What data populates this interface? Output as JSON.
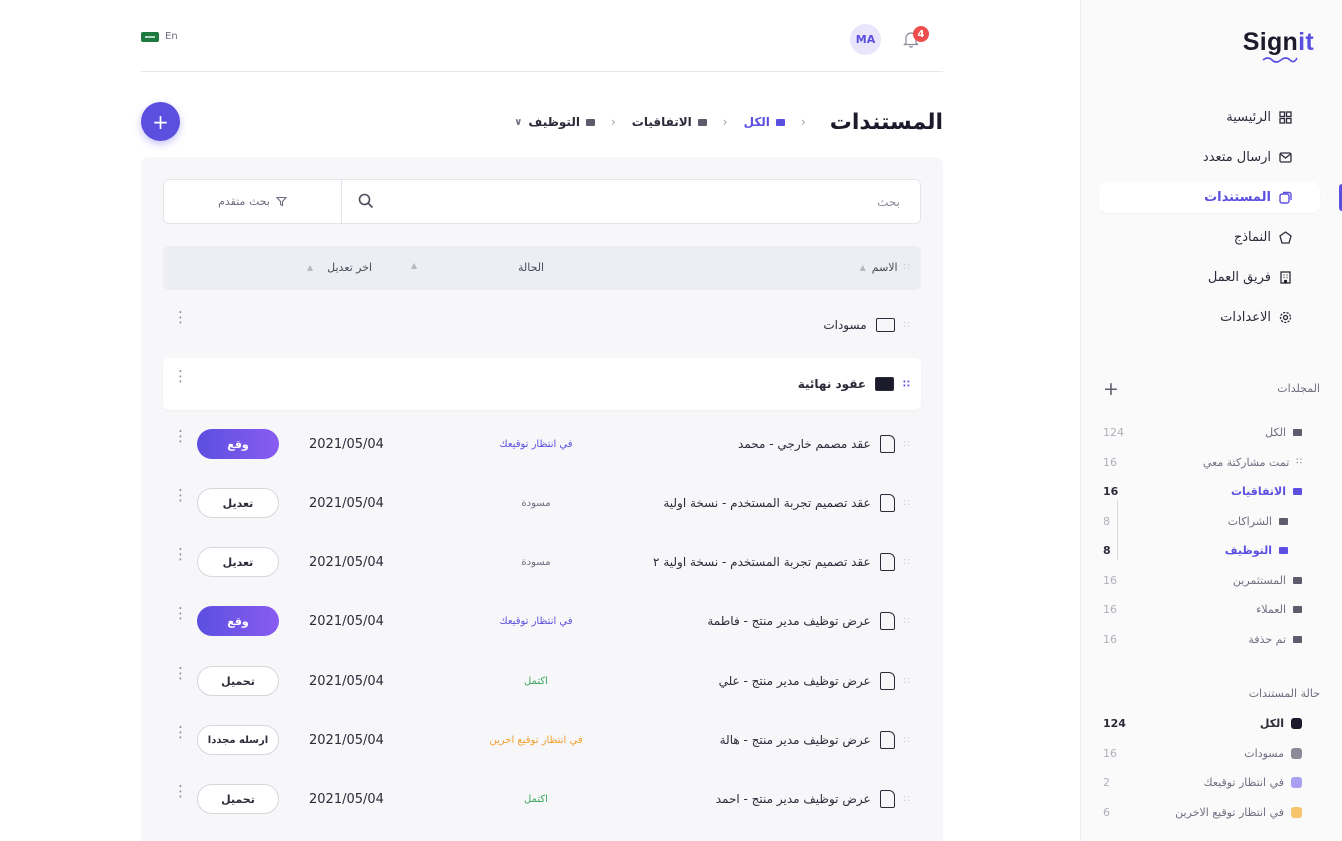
{
  "app": {
    "logo_prefix": "Sign",
    "logo_suffix": "it"
  },
  "topbar": {
    "language": "En",
    "avatar_initials": "MA",
    "notifications_count": "4"
  },
  "nav": {
    "items": [
      {
        "label": "الرئيسية",
        "icon": "grid-icon",
        "active": false
      },
      {
        "label": "ارسال متعدد",
        "icon": "mail-icon",
        "active": false
      },
      {
        "label": "المستندات",
        "icon": "documents-icon",
        "active": true
      },
      {
        "label": "النماذج",
        "icon": "template-icon",
        "active": false
      },
      {
        "label": "فريق العمل",
        "icon": "building-icon",
        "active": false
      },
      {
        "label": "الاعدادات",
        "icon": "gear-icon",
        "active": false
      }
    ]
  },
  "folders": {
    "title": "المجلدات",
    "items": [
      {
        "label": "الكل",
        "count": "124"
      },
      {
        "label": "تمت مشاركتة معي",
        "count": "16"
      },
      {
        "label": "الاتفاقيات",
        "count": "16"
      },
      {
        "label": "الشراكات",
        "count": "8"
      },
      {
        "label": "التوظيف",
        "count": "8"
      },
      {
        "label": "المستثمرين",
        "count": "16"
      },
      {
        "label": "العملاء",
        "count": "16"
      },
      {
        "label": "تم حذفة",
        "count": "16"
      }
    ]
  },
  "doc_status": {
    "title": "حالة المستندات",
    "items": [
      {
        "label": "الكل",
        "count": "124",
        "color": "#1b1b2b"
      },
      {
        "label": "مسودات",
        "count": "16",
        "color": "#8a8a98"
      },
      {
        "label": "في انتظار توقيعك",
        "count": "2",
        "color": "#a9a0f0"
      },
      {
        "label": "في انتظار توقيع الاخرين",
        "count": "6",
        "color": "#f5c46b"
      }
    ]
  },
  "header": {
    "title": "المستندات",
    "breadcrumbs": [
      "الكل",
      "الاتفاقيات",
      "التوظيف"
    ],
    "add_label": "+"
  },
  "search": {
    "placeholder": "بحث",
    "advanced_label": "بحث متقدم"
  },
  "table": {
    "columns": {
      "name": "الاسم",
      "status": "الحالة",
      "modified": "اخر تعديل"
    },
    "folders": [
      "مسودات",
      "عقود نهائية"
    ],
    "rows": [
      {
        "name": "عقد مصمم خارجي - محمد",
        "status": "في انتظار توقيعك",
        "status_color": "#5b4fe0",
        "date": "2021/05/04",
        "action": "وقع",
        "primary": true
      },
      {
        "name": "عقد تصميم تجربة المستخدم - نسخة اولية",
        "status": "مسودة",
        "status_color": "#6e6e80",
        "date": "2021/05/04",
        "action": "تعديل",
        "primary": false
      },
      {
        "name": "عقد تصميم تجربة المستخدم - نسخة اولية ٢",
        "status": "مسودة",
        "status_color": "#6e6e80",
        "date": "2021/05/04",
        "action": "تعديل",
        "primary": false
      },
      {
        "name": "عرض توظيف مدير منتج - فاطمة",
        "status": "في انتظار توقيعك",
        "status_color": "#5b4fe0",
        "date": "2021/05/04",
        "action": "وقع",
        "primary": true
      },
      {
        "name": "عرض توظيف مدير منتج - علي",
        "status": "اكتمل",
        "status_color": "#3aa55d",
        "date": "2021/05/04",
        "action": "تحميل",
        "primary": false
      },
      {
        "name": "عرض توظيف مدير منتج - هالة",
        "status": "في انتظار توقيع اخرين",
        "status_color": "#f0a030",
        "date": "2021/05/04",
        "action": "ارسله مجددا",
        "primary": false
      },
      {
        "name": "عرض توظيف مدير منتج - احمد",
        "status": "اكتمل",
        "status_color": "#3aa55d",
        "date": "2021/05/04",
        "action": "تحميل",
        "primary": false
      }
    ]
  }
}
